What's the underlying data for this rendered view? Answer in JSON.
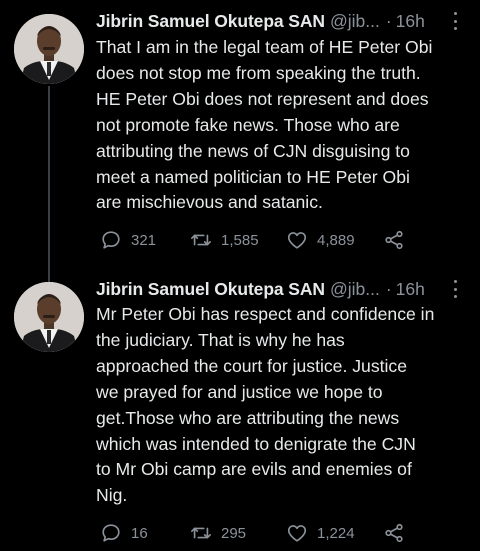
{
  "tweets": [
    {
      "author_name": "Jibrin Samuel Okutepa SAN",
      "handle": "@jib...",
      "separator": "·",
      "time": "16h",
      "text": "That I am in the legal team of HE Peter Obi\ndoes not stop me from speaking the truth.\nHE Peter Obi does not represent and does\nnot promote fake news. Those who are\nattributing the news of CJN disguising to\nmeet a named politician to HE Peter Obi\nare mischievous and satanic.",
      "replies": "321",
      "retweets": "1,585",
      "likes": "4,889"
    },
    {
      "author_name": "Jibrin Samuel Okutepa SAN",
      "handle": "@jib...",
      "separator": "·",
      "time": "16h",
      "text": "Mr Peter Obi has respect and confidence in\nthe judiciary. That is why he has\napproached the court for justice. Justice\nwe prayed for and justice we hope to\nget.Those who are attributing the news\nwhich was intended to denigrate the CJN\nto Mr Obi camp are evils and enemies of\nNig.",
      "replies": "16",
      "retweets": "295",
      "likes": "1,224"
    }
  ],
  "icons": {
    "reply": "reply-icon",
    "retweet": "retweet-icon",
    "like": "heart-icon",
    "share": "share-icon",
    "more": "more-vertical-icon"
  },
  "colors": {
    "background": "#000000",
    "text": "#e7e9ea",
    "secondary": "#8b9299",
    "thread_line": "#3a3f44"
  }
}
